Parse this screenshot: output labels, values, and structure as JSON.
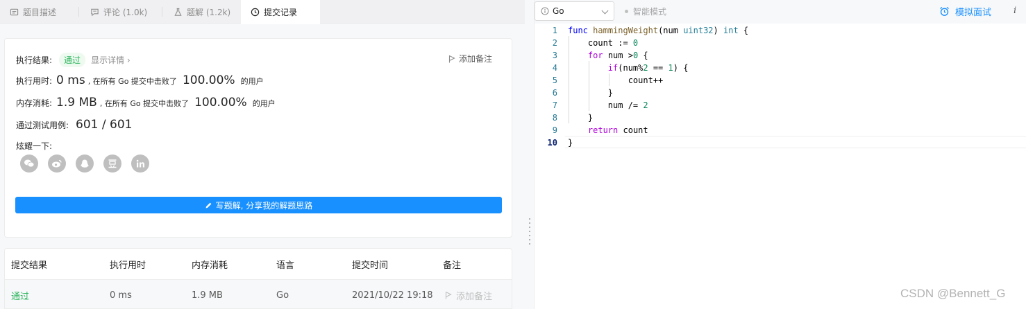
{
  "tabs": [
    {
      "label": "题目描述",
      "icon": "description-icon",
      "active": false
    },
    {
      "label": "评论 (1.0k)",
      "icon": "comment-icon",
      "active": false
    },
    {
      "label": "题解 (1.2k)",
      "icon": "flask-icon",
      "active": false
    },
    {
      "label": "提交记录",
      "icon": "clock-icon",
      "active": true
    }
  ],
  "result": {
    "label": "执行结果:",
    "status": "通过",
    "details_link": "显示详情 ›",
    "add_note": "添加备注",
    "runtime_label": "执行用时:",
    "runtime_value": "0 ms",
    "runtime_beat_text": ", 在所有 Go 提交中击败了",
    "runtime_percent": "100.00%",
    "runtime_users": "的用户",
    "memory_label": "内存消耗:",
    "memory_value": "1.9 MB",
    "memory_beat_text": ", 在所有 Go 提交中击败了",
    "memory_percent": "100.00%",
    "memory_users": "的用户",
    "tests_label": "通过测试用例:",
    "tests_value": "601 / 601",
    "share_label": "炫耀一下:",
    "share_icons": [
      "wechat-icon",
      "weibo-icon",
      "qq-icon",
      "douban-icon",
      "linkedin-icon"
    ],
    "write_solution": "写题解, 分享我的解题思路"
  },
  "table": {
    "headers": [
      "提交结果",
      "执行用时",
      "内存消耗",
      "语言",
      "提交时间",
      "备注"
    ],
    "row": {
      "result": "通过",
      "runtime": "0 ms",
      "memory": "1.9 MB",
      "language": "Go",
      "time": "2021/10/22 19:18",
      "note": "添加备注"
    }
  },
  "editor": {
    "language": "Go",
    "mode": "智能模式",
    "interview": "模拟面试",
    "info": "i",
    "line_numbers": [
      "1",
      "2",
      "3",
      "4",
      "5",
      "6",
      "7",
      "8",
      "9",
      "10"
    ]
  },
  "watermark": "CSDN @Bennett_G",
  "colors": {
    "accent": "#1890ff",
    "success": "#2db55d",
    "keyword": "#0000ff",
    "control": "#af00db",
    "function": "#795e26",
    "type": "#267f99",
    "number": "#098658"
  }
}
